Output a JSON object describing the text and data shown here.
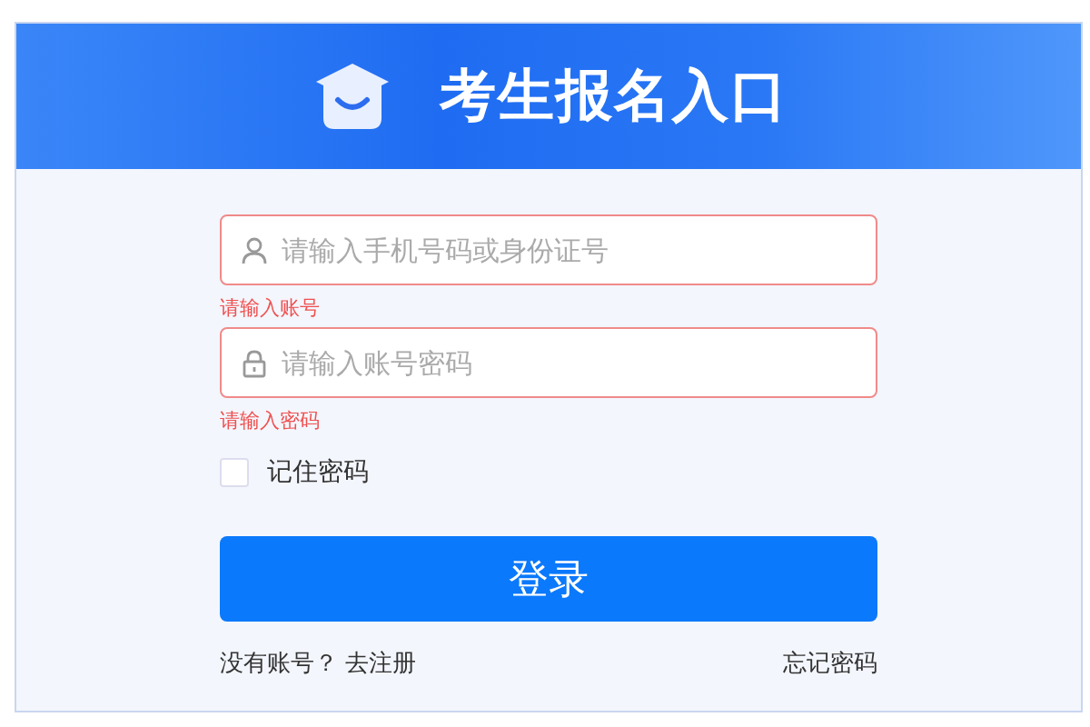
{
  "header": {
    "title": "考生报名入口"
  },
  "fields": [
    {
      "kind": "user",
      "placeholder": "请输入手机号码或身份证号",
      "error": "请输入账号"
    },
    {
      "kind": "lock",
      "placeholder": "请输入账号密码",
      "error": "请输入密码"
    }
  ],
  "remember": {
    "label": "记住密码",
    "checked": false
  },
  "login_button": "登录",
  "footer": {
    "prompt": "没有账号？",
    "register_link": "去注册",
    "forgot_link": "忘记密码"
  }
}
